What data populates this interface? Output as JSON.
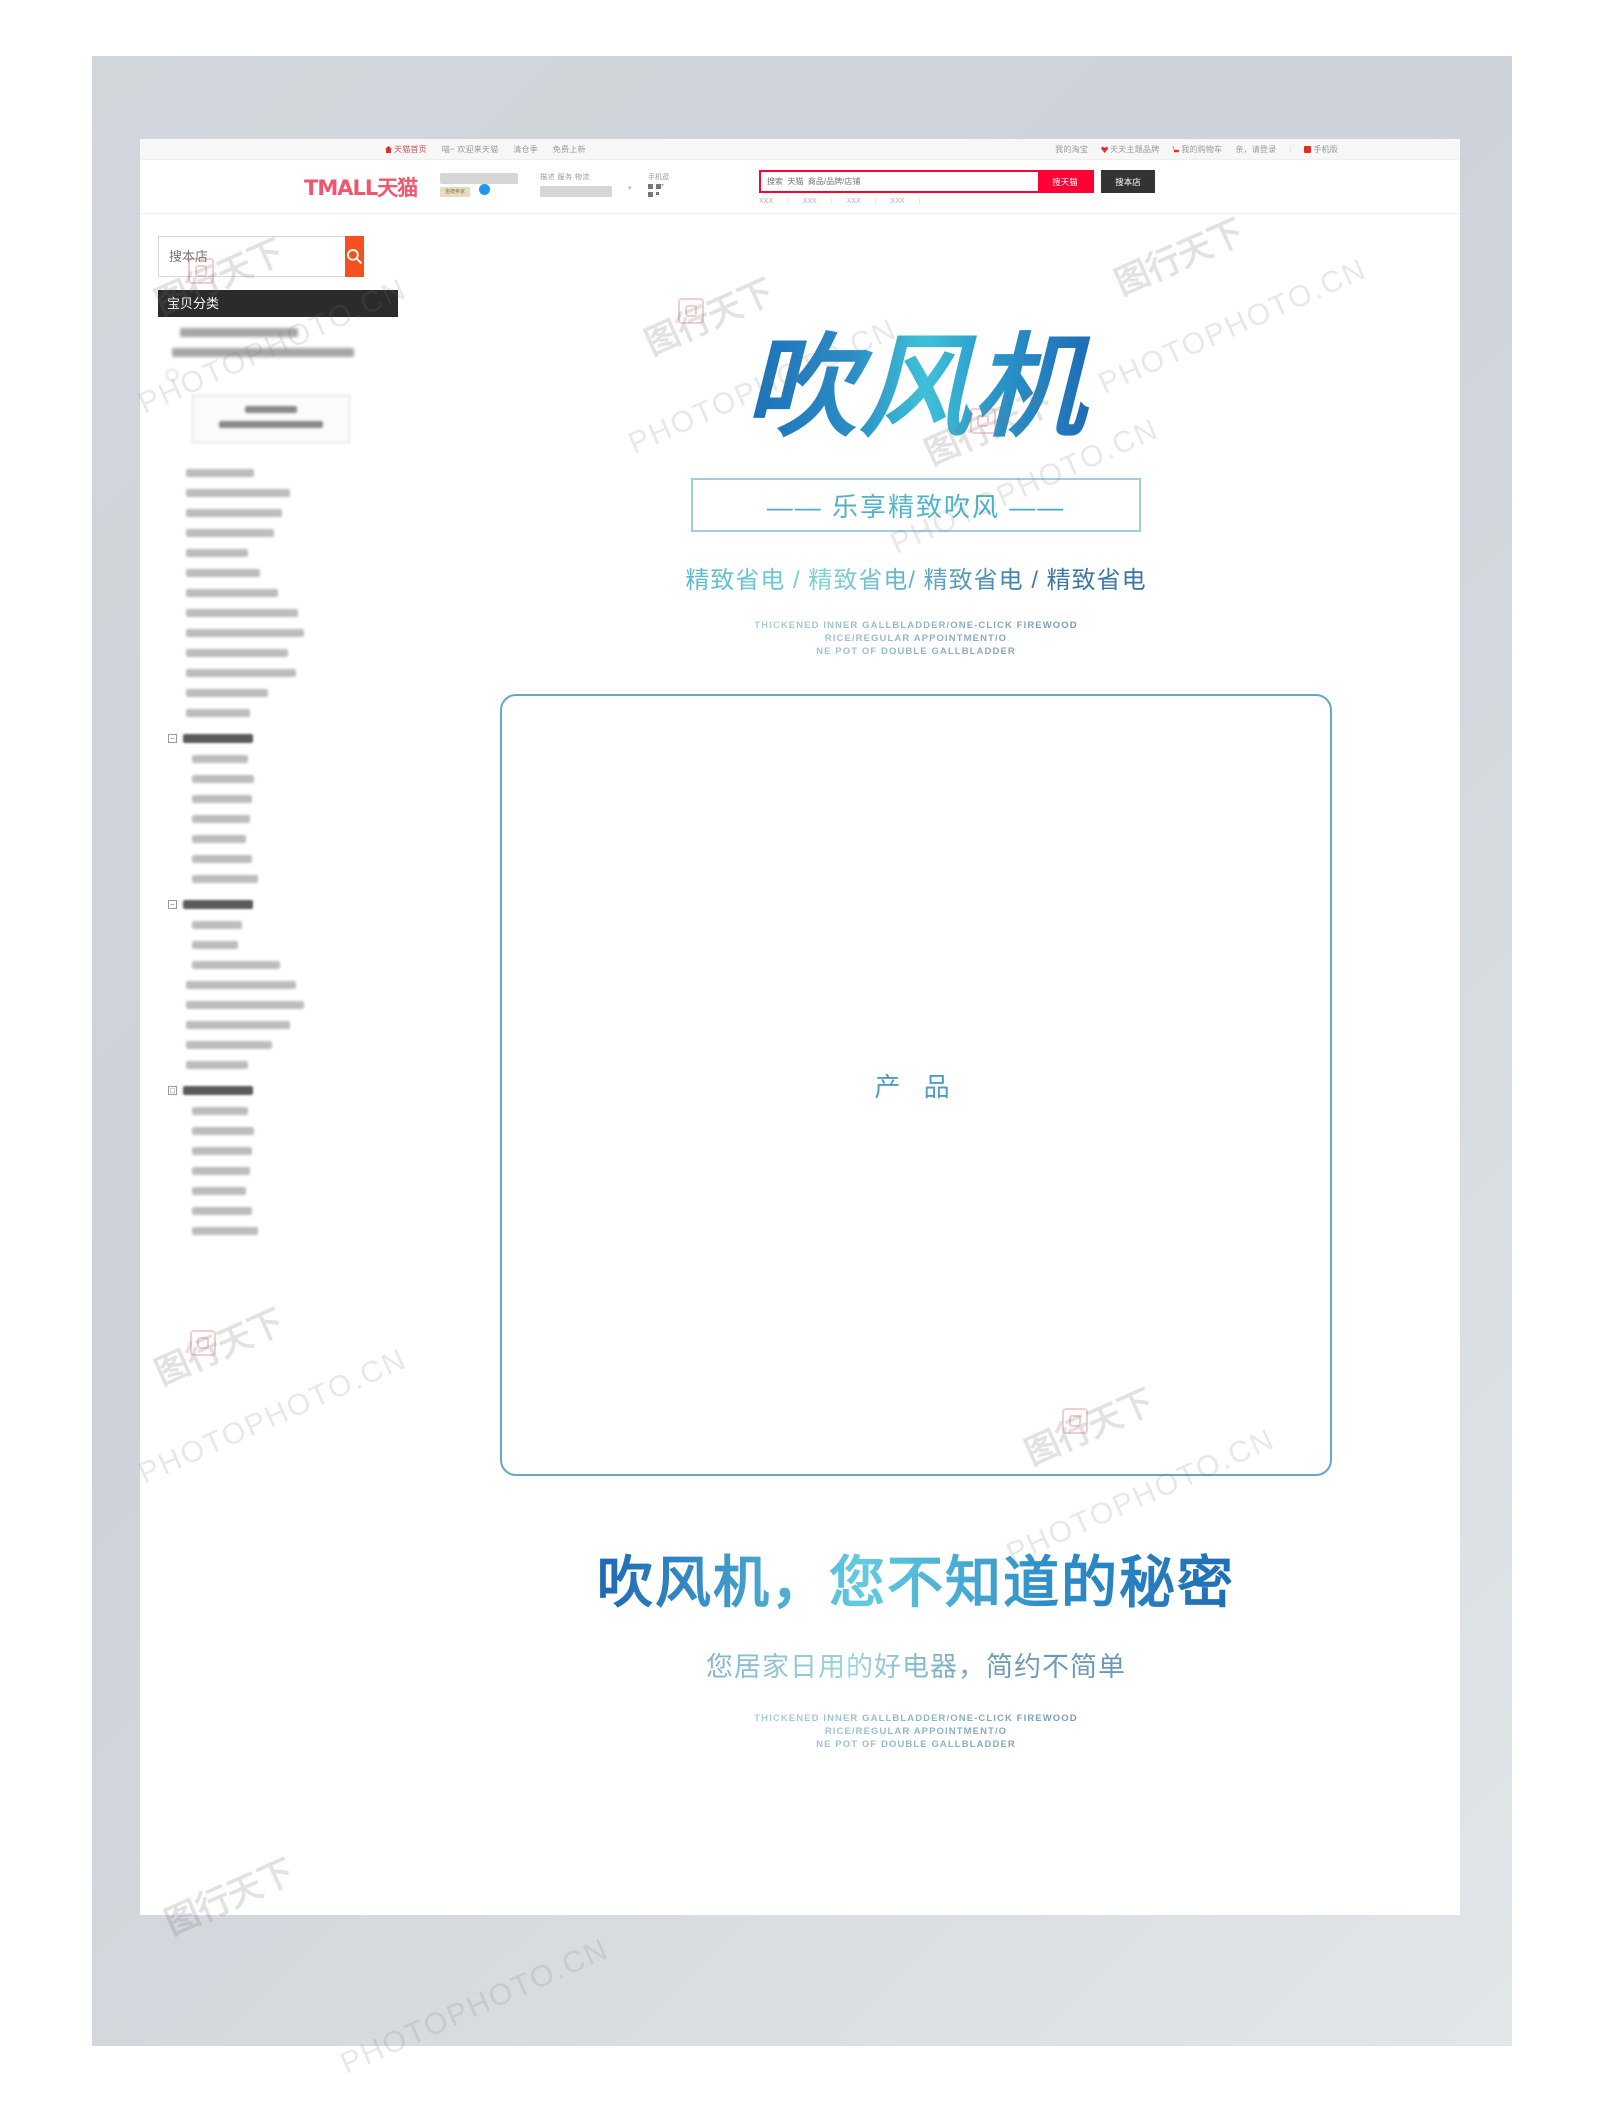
{
  "tmall_topbar": {
    "left_links": [
      "天猫首页",
      "喵~ 欢迎来天猫",
      "清仓季",
      "免费上新"
    ],
    "right_links": [
      "我的淘宝",
      "天天主题品牌",
      "我的购物车",
      "亲，请登录",
      "手机版"
    ]
  },
  "tmall_header": {
    "logo": "TMALL天猫",
    "shop_badge": "金牌卖家",
    "shipping_label": "描述 服务 物流",
    "mobile_label": "手机逛",
    "search_placeholder": "搜索  天猫  商品/品牌/店铺",
    "search_tmall_button": "搜天猫",
    "search_shop_button": "搜本店",
    "hot_words": [
      "XXX",
      "XXX",
      "XXX",
      "XXX"
    ]
  },
  "sidebar": {
    "search_placeholder": "搜本店",
    "search_icon": "search-icon",
    "category_header": "宝贝分类",
    "groups": [
      {
        "toggle": "−",
        "label": "热销上装"
      },
      {
        "toggle": "−",
        "label": "热销下装"
      },
      {
        "toggle": "□",
        "label": "热销上装"
      }
    ]
  },
  "main": {
    "hero_title": "吹风机",
    "slogan": "—— 乐享精致吹风 ——",
    "feature_line": "精致省电 / 精致省电/ 精致省电 / 精致省电",
    "english_lines": [
      "THICKENED INNER GALLBLADDER/ONE-CLICK FIREWOOD",
      "RICE/REGULAR APPOINTMENT/O",
      "NE POT OF DOUBLE GALLBLADDER"
    ],
    "product_placeholder": "产 品",
    "bottom_title": "吹风机，您不知道的秘密",
    "bottom_sub": "您居家日用的好电器，简约不简单",
    "bottom_english_lines": [
      "THICKENED INNER GALLBLADDER/ONE-CLICK FIREWOOD",
      "RICE/REGULAR APPOINTMENT/O",
      "NE POT OF DOUBLE GALLBLADDER"
    ]
  },
  "watermarks": {
    "latin": "PHOTOPHOTO.CN",
    "cn": "图行天下",
    "cn2": "图行天下"
  },
  "colors": {
    "tmall_red": "#ff0036",
    "shop_button_dark": "#333333",
    "sidebar_search_orange": "#f4511e",
    "accent_blue": "#1f6cb5",
    "accent_cyan": "#63cbe0",
    "frame_border": "#63a8cc"
  }
}
